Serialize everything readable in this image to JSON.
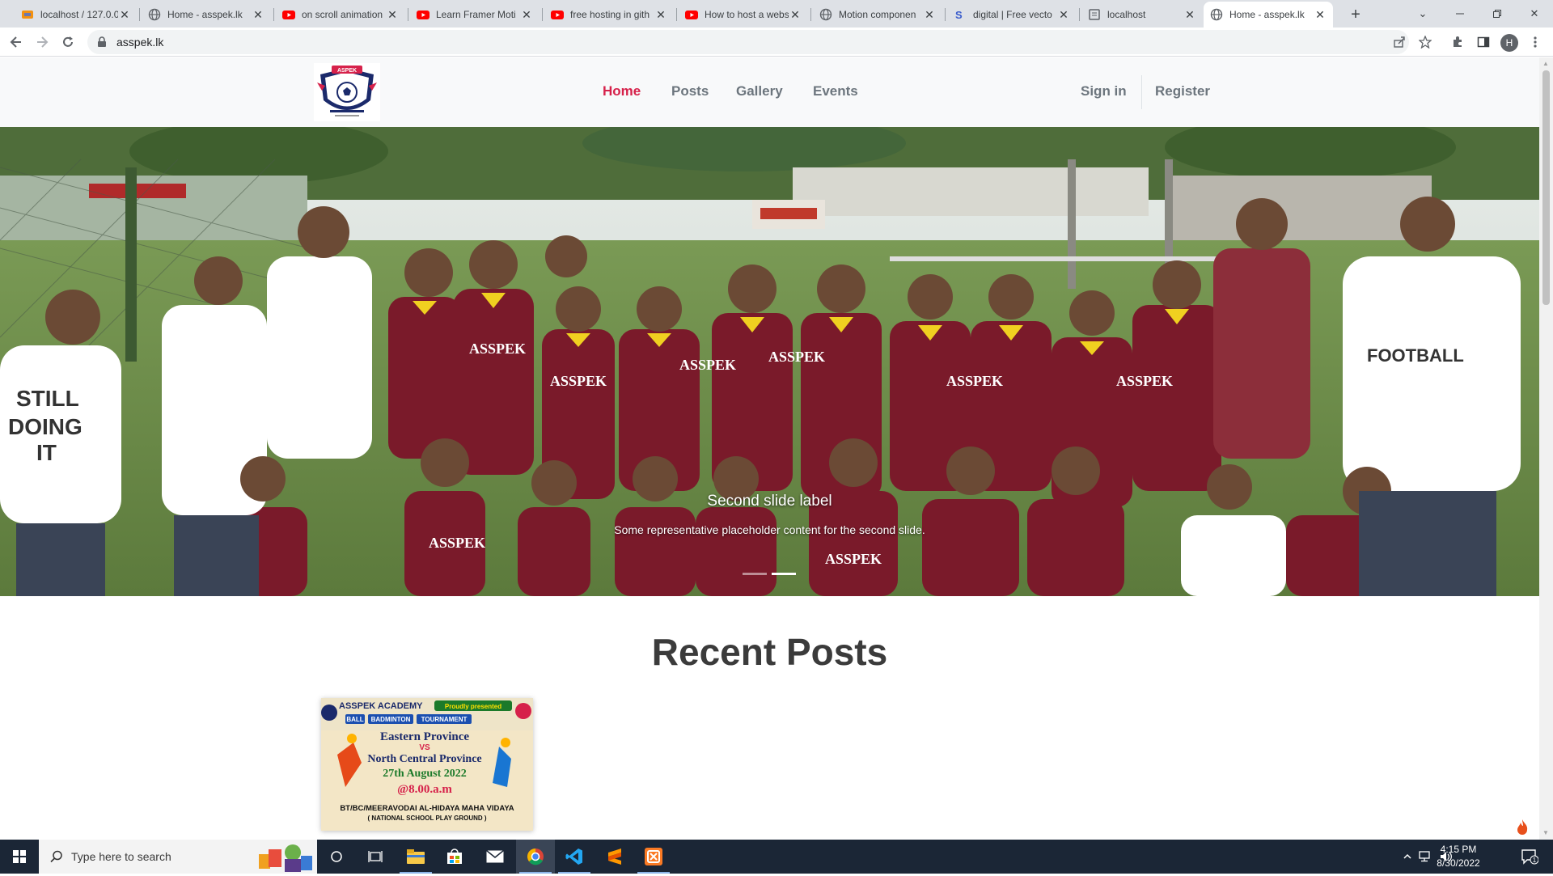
{
  "browser": {
    "tabs": [
      {
        "title": "localhost / 127.0.0.",
        "icon": "phpmyadmin-icon",
        "active": false
      },
      {
        "title": "Home - asspek.lk",
        "icon": "globe-icon",
        "active": false
      },
      {
        "title": "on scroll animation",
        "icon": "youtube-icon",
        "active": false
      },
      {
        "title": "Learn Framer Moti",
        "icon": "youtube-icon",
        "active": false
      },
      {
        "title": "free hosting in gith",
        "icon": "youtube-icon",
        "active": false
      },
      {
        "title": "How to host a webs",
        "icon": "youtube-icon",
        "active": false
      },
      {
        "title": "Motion componen",
        "icon": "globe-icon",
        "active": false
      },
      {
        "title": "digital | Free vecto",
        "icon": "shutterstock-icon",
        "active": false
      },
      {
        "title": "localhost",
        "icon": "page-icon",
        "active": false
      },
      {
        "title": "Home - asspek.lk",
        "icon": "globe-icon",
        "active": true
      }
    ],
    "address": "asspek.lk",
    "profile_initial": "H"
  },
  "site": {
    "logo_text": "ASPEK",
    "nav": {
      "home": "Home",
      "posts": "Posts",
      "gallery": "Gallery",
      "events": "Events",
      "signin": "Sign in",
      "register": "Register"
    },
    "carousel": {
      "title": "Second slide label",
      "text": "Some representative placeholder content for the second slide.",
      "slide_count": 2,
      "active_index": 1
    },
    "recent_posts_title": "Recent Posts",
    "post": {
      "line1": "ASSPEK ACADEMY",
      "line1b": "Proudly presented",
      "line2": [
        "BALL",
        "BADMINTON",
        "TOURNAMENT"
      ],
      "line3": "Eastern Province",
      "vs": "VS",
      "line4": "North Central Province",
      "date": "27th August 2022",
      "time": "@8.00.a.m",
      "venue1": "BT/BC/MEERAVODAI AL-HIDAYA MAHA VIDAYA",
      "venue2": "( NATIONAL SCHOOL PLAY GROUND )"
    }
  },
  "taskbar": {
    "search_placeholder": "Type here to search",
    "time": "4:15 PM",
    "date": "8/30/2022",
    "notification_count": "1"
  },
  "colors": {
    "nav_active": "#d6214a",
    "jersey": "#7a1a2a",
    "jersey_collar": "#f0d020"
  }
}
